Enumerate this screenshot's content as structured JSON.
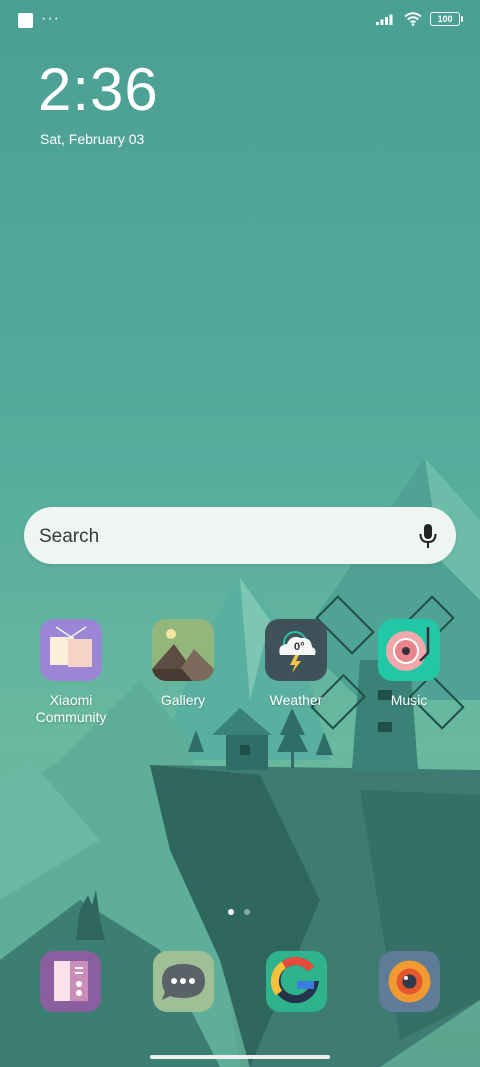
{
  "status_bar": {
    "overflow_dots": "···",
    "battery_level": "100"
  },
  "clock": {
    "time": "2:36",
    "date": "Sat, February 03"
  },
  "search": {
    "placeholder": "Search"
  },
  "apps": [
    {
      "label": "Xiaomi\nCommunity",
      "icon": "xiaomi-community-icon"
    },
    {
      "label": "Gallery",
      "icon": "gallery-icon"
    },
    {
      "label": "Weather",
      "icon": "weather-icon",
      "temperature": "0°"
    },
    {
      "label": "Music",
      "icon": "music-icon"
    }
  ],
  "dock": [
    {
      "icon": "file-manager-icon"
    },
    {
      "icon": "messages-icon"
    },
    {
      "icon": "google-icon"
    },
    {
      "icon": "camera-icon"
    }
  ],
  "page_indicator": {
    "pages": 2,
    "current": 1
  },
  "colors": {
    "background": "#4a9f93",
    "search_bg": "#eff5f3"
  }
}
